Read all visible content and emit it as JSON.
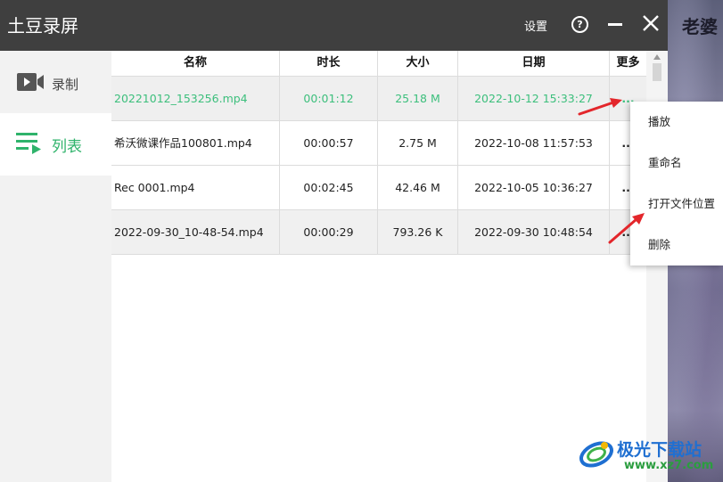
{
  "app": {
    "title": "土豆录屏",
    "settings_label": "设置",
    "help_label": "?"
  },
  "background": {
    "text": "老婆"
  },
  "sidebar": {
    "items": [
      {
        "label": "录制",
        "icon": "video-camera-icon"
      },
      {
        "label": "列表",
        "icon": "playlist-icon"
      }
    ]
  },
  "table": {
    "headers": [
      "名称",
      "时长",
      "大小",
      "日期",
      "更多"
    ],
    "rows": [
      {
        "name": "20221012_153256.mp4",
        "duration": "00:01:12",
        "size": "25.18 M",
        "date": "2022-10-12 15:33:27",
        "more": "..."
      },
      {
        "name": "希沃微课作品100801.mp4",
        "duration": "00:00:57",
        "size": "2.75 M",
        "date": "2022-10-08 11:57:53",
        "more": "..."
      },
      {
        "name": "Rec 0001.mp4",
        "duration": "00:02:45",
        "size": "42.46 M",
        "date": "2022-10-05 10:36:27",
        "more": "..."
      },
      {
        "name": "2022-09-30_10-48-54.mp4",
        "duration": "00:00:29",
        "size": "793.26 K",
        "date": "2022-09-30 10:48:54",
        "more": "..."
      }
    ]
  },
  "context_menu": {
    "items": [
      "播放",
      "重命名",
      "打开文件位置",
      "删除"
    ]
  },
  "watermark": {
    "title": "极光下载站",
    "url": "www.xz7.com"
  },
  "colors": {
    "accent": "#2fb36b",
    "titlebar": "#3f3f3f",
    "arrow": "#e3262b",
    "watermark_blue": "#1f6fd1"
  }
}
